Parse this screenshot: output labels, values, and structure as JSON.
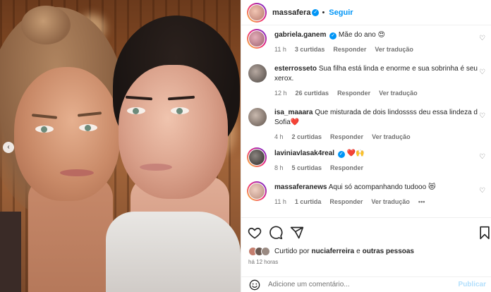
{
  "post": {
    "author": "massafera",
    "follow_label": "Seguir",
    "separator": "•"
  },
  "comments": [
    {
      "user": "gabriela.ganem",
      "verified": true,
      "text": "Mãe do ano 😍",
      "time": "11 h",
      "likes": "3 curtidas",
      "reply": "Responder",
      "translate": "Ver tradução",
      "avatar_color": "#c78b9a"
    },
    {
      "user": "esterrosseto",
      "verified": false,
      "text": "Sua filha está linda e enorme e sua sobrinha é seu xerox.",
      "time": "12 h",
      "likes": "26 curtidas",
      "reply": "Responder",
      "translate": "Ver tradução",
      "avatar_color": "#5b5551"
    },
    {
      "user": "isa_maaara",
      "verified": false,
      "text": "Que misturada de dois lindossss deu essa lindeza d Sofia❤️",
      "time": "4 h",
      "likes": "2 curtidas",
      "reply": "Responder",
      "translate": "Ver tradução",
      "avatar_color": "#7a6f68"
    },
    {
      "user": "laviniavlasak4real",
      "verified": true,
      "text": "❤️🙌",
      "time": "8 h",
      "likes": "5 curtidas",
      "reply": "Responder",
      "translate": "",
      "avatar_color": "#3d3a38"
    },
    {
      "user": "massaferanews",
      "verified": false,
      "text": "Aqui só acompanhando tudooo 😻",
      "time": "11 h",
      "likes": "1 curtida",
      "reply": "Responder",
      "translate": "Ver tradução",
      "more": "•••",
      "avatar_color": "#d6b3a5"
    }
  ],
  "actions": {
    "icons": [
      "heart-icon",
      "comment-icon",
      "share-icon",
      "bookmark-icon"
    ]
  },
  "liked_by": {
    "prefix": "Curtido por",
    "user": "nuciaferreira",
    "connector": "e",
    "rest": "outras pessoas"
  },
  "posted_time": "há 12 horas",
  "add_comment": {
    "placeholder": "Adicione um comentário...",
    "publish": "Publicar"
  },
  "colors": {
    "accent": "#0095f6",
    "meta_text": "#737373",
    "border": "#efefef",
    "heart_red": "#e0245e"
  }
}
